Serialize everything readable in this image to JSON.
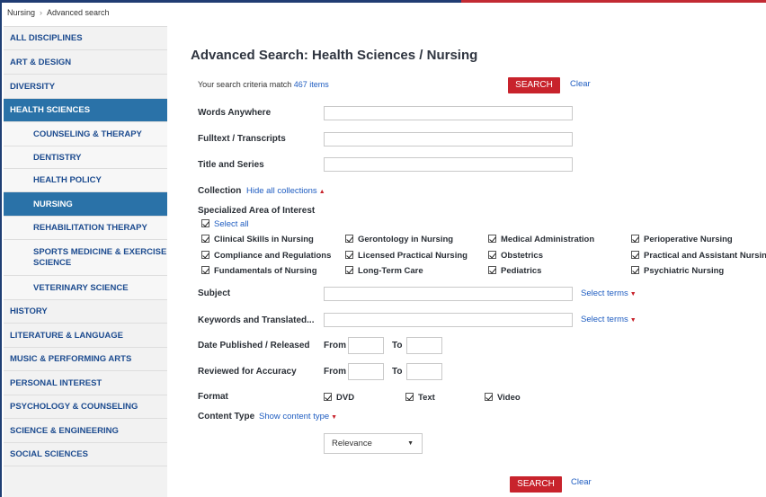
{
  "breadcrumb": {
    "items": [
      "Nursing",
      "Advanced search"
    ],
    "separator": "›"
  },
  "sidebar": {
    "items": [
      {
        "label": "ALL DISCIPLINES"
      },
      {
        "label": "ART & DESIGN"
      },
      {
        "label": "DIVERSITY"
      },
      {
        "label": "HEALTH SCIENCES"
      },
      {
        "label": "COUNSELING & THERAPY"
      },
      {
        "label": "DENTISTRY"
      },
      {
        "label": "HEALTH POLICY"
      },
      {
        "label": "NURSING"
      },
      {
        "label": "REHABILITATION THERAPY"
      },
      {
        "label": "SPORTS MEDICINE & EXERCISE SCIENCE"
      },
      {
        "label": "VETERINARY SCIENCE"
      },
      {
        "label": "HISTORY"
      },
      {
        "label": "LITERATURE & LANGUAGE"
      },
      {
        "label": "MUSIC & PERFORMING ARTS"
      },
      {
        "label": "PERSONAL INTEREST"
      },
      {
        "label": "PSYCHOLOGY & COUNSELING"
      },
      {
        "label": "SCIENCE & ENGINEERING"
      },
      {
        "label": "SOCIAL SCIENCES"
      }
    ]
  },
  "main": {
    "title": "Advanced Search: Health Sciences / Nursing",
    "criteria_prefix": "Your search criteria match",
    "criteria_count": "467 items",
    "search_label": "SEARCH",
    "clear_label": "Clear",
    "fields": {
      "words_anywhere": "Words Anywhere",
      "fulltext": "Fulltext / Transcripts",
      "title_series": "Title and Series"
    },
    "collection": {
      "label": "Collection",
      "toggle": "Hide all collections",
      "caret": "▲"
    },
    "interest": {
      "label": "Specialized Area of Interest",
      "select_all": "Select all",
      "options": [
        "Clinical Skills in Nursing",
        "Gerontology in Nursing",
        "Medical Administration",
        "Perioperative Nursing",
        "Compliance and Regulations",
        "Licensed Practical Nursing",
        "Obstetrics",
        "Practical and Assistant Nursing",
        "Fundamentals of Nursing",
        "Long-Term Care",
        "Pediatrics",
        "Psychiatric Nursing"
      ]
    },
    "subject": {
      "label": "Subject",
      "link": "Select terms",
      "caret": "▼"
    },
    "keywords": {
      "label": "Keywords and Translated...",
      "link": "Select terms",
      "caret": "▼"
    },
    "date_published": {
      "label": "Date Published / Released",
      "from": "From",
      "to": "To"
    },
    "reviewed": {
      "label": "Reviewed for Accuracy",
      "from": "From",
      "to": "To"
    },
    "format": {
      "label": "Format",
      "options": [
        "DVD",
        "Text",
        "Video"
      ]
    },
    "content_type": {
      "label": "Content Type",
      "link": "Show content type",
      "caret": "▼"
    },
    "sort": {
      "value": "Relevance",
      "caret": "▼"
    }
  },
  "colors": {
    "nav_active": "#2a72a8",
    "nav_text": "#1c4b8f",
    "search_button": "#c8232c",
    "link": "#1f5dc1"
  }
}
